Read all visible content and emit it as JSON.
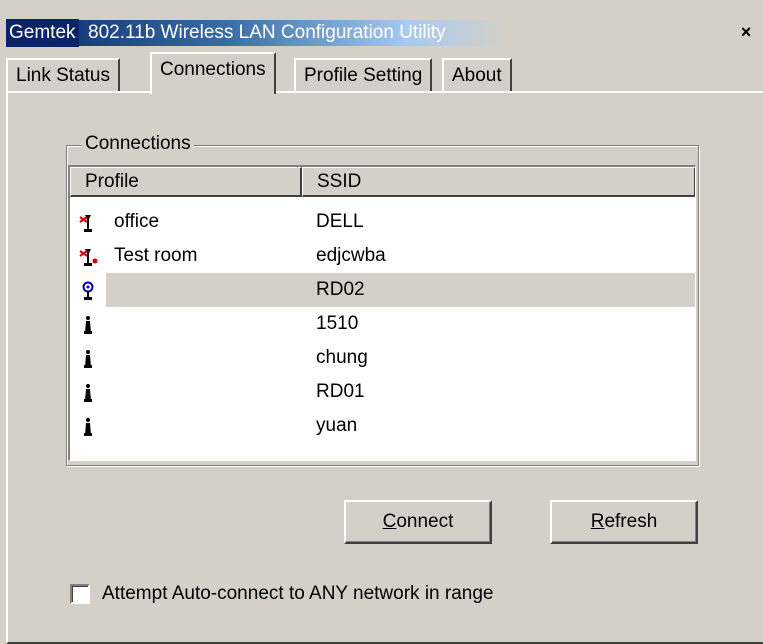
{
  "window": {
    "brand": "Gemtek",
    "title": "802.11b Wireless LAN Configuration Utility",
    "close_glyph": "×"
  },
  "tabs": [
    {
      "label": "Link Status",
      "active": false
    },
    {
      "label": "Connections",
      "active": true
    },
    {
      "label": "Profile Setting",
      "active": false
    },
    {
      "label": "About",
      "active": false
    }
  ],
  "connections": {
    "group_label": "Connections",
    "columns": {
      "profile": "Profile",
      "ssid": "SSID"
    },
    "rows": [
      {
        "icon": "red-station-icon",
        "profile": "office",
        "ssid": "DELL",
        "selected": false
      },
      {
        "icon": "red-station-connected-icon",
        "profile": "Test room",
        "ssid": "edjcwba",
        "selected": false
      },
      {
        "icon": "blue-antenna-icon",
        "profile": "",
        "ssid": "RD02",
        "selected": true
      },
      {
        "icon": "black-station-icon",
        "profile": "",
        "ssid": "1510",
        "selected": false
      },
      {
        "icon": "black-station-icon",
        "profile": "",
        "ssid": "chung",
        "selected": false
      },
      {
        "icon": "black-station-icon",
        "profile": "",
        "ssid": "RD01",
        "selected": false
      },
      {
        "icon": "black-station-icon",
        "profile": "",
        "ssid": "yuan",
        "selected": false
      }
    ]
  },
  "buttons": {
    "connect": {
      "mnemonic": "C",
      "rest": "onnect"
    },
    "refresh": {
      "mnemonic": "R",
      "rest": "efresh"
    }
  },
  "auto_connect": {
    "label": "Attempt Auto-connect to ANY network in range",
    "checked": false
  },
  "colors": {
    "title_active": "#0a246a",
    "window_face": "#d4d0c8",
    "icon_red": "#d00000",
    "icon_blue": "#0000c0"
  }
}
